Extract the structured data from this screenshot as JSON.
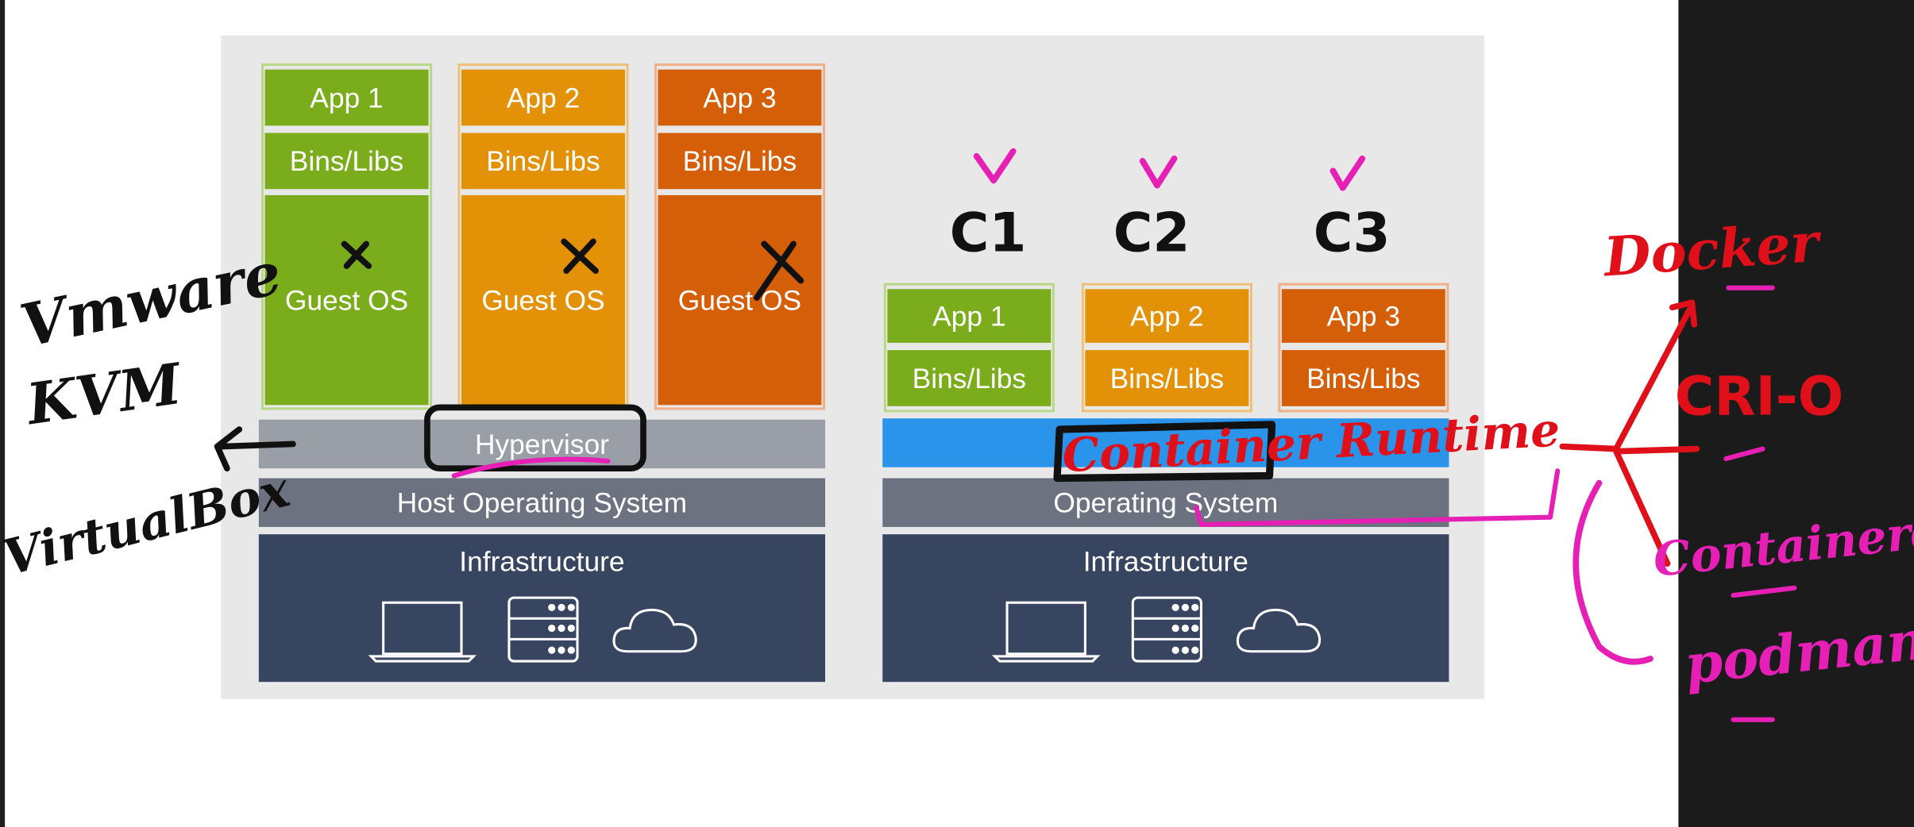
{
  "diagram": {
    "vm_side": {
      "apps": [
        {
          "app": "App 1",
          "libs": "Bins/Libs",
          "os": "Guest OS"
        },
        {
          "app": "App 2",
          "libs": "Bins/Libs",
          "os": "Guest OS"
        },
        {
          "app": "App 3",
          "libs": "Bins/Libs",
          "os": "Guest OS"
        }
      ],
      "hypervisor": "Hypervisor",
      "host_os": "Host Operating System",
      "infrastructure": "Infrastructure"
    },
    "container_side": {
      "apps": [
        {
          "app": "App 1",
          "libs": "Bins/Libs"
        },
        {
          "app": "App 2",
          "libs": "Bins/Libs"
        },
        {
          "app": "App 3",
          "libs": "Bins/Libs"
        }
      ],
      "os": "Operating System",
      "infrastructure": "Infrastructure"
    }
  },
  "annotations": {
    "hypervisors": [
      "Vmware",
      "KVM",
      "VirtualBox"
    ],
    "container_labels": [
      "C1",
      "C2",
      "C3"
    ],
    "runtime": "Container Runtime",
    "runtimes": [
      "Docker",
      "CRI-O",
      "Containerd",
      "podman"
    ]
  },
  "colors": {
    "green": "#7aac1c",
    "orange": "#e39208",
    "dark_orange": "#d55e08",
    "navy": "#384560",
    "runtime_blue": "#2a93ea",
    "ink_red": "#e0101a",
    "ink_magenta": "#e61fb5"
  }
}
